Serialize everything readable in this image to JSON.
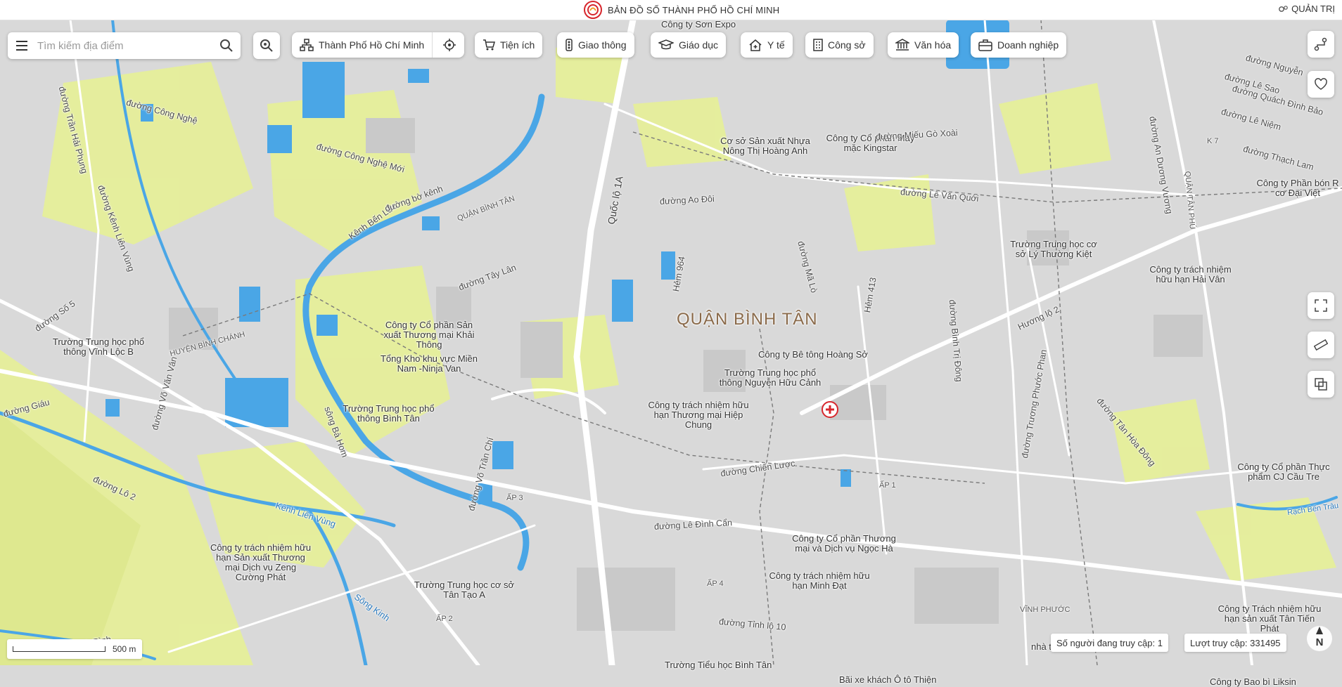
{
  "header": {
    "title": "BẢN ĐỒ SỐ THÀNH PHỐ HỒ CHÍ MINH",
    "admin_label": "QUẢN TRỊ",
    "logo_icon": "city-logo-icon"
  },
  "search": {
    "placeholder": "Tìm kiếm địa điểm"
  },
  "toolbar": {
    "city_selector": "Thành Phố Hồ Chí Minh",
    "categories": [
      {
        "label": "Tiện ích",
        "icon": "cart-icon"
      },
      {
        "label": "Giao thông",
        "icon": "traffic-light-icon"
      },
      {
        "label": "Giáo dục",
        "icon": "graduation-cap-icon"
      },
      {
        "label": "Y tế",
        "icon": "medical-house-icon"
      },
      {
        "label": "Công sở",
        "icon": "office-building-icon"
      },
      {
        "label": "Văn hóa",
        "icon": "museum-icon"
      },
      {
        "label": "Doanh nghiệp",
        "icon": "briefcase-icon"
      }
    ]
  },
  "map": {
    "district": "QUẬN BÌNH TÂN",
    "labels": [
      "Công ty Sơn Expo",
      "đường Công Nghệ",
      "đường Trần Hải Phụng",
      "đường Công Nghệ Mới",
      "đường Kênh Liên Vùng",
      "Kênh Bến Lức",
      "đường bờ kênh",
      "QUẬN BÌNH TÂN",
      "HUYỆN BÌNH CHÁNH",
      "đường Tây Lân",
      "Quốc lộ 1A",
      "đường Ao Đôi",
      "Hẻm 964",
      "đường Mã Lò",
      "Hẻm 413",
      "Cơ sở Sản xuất Nhựa Nông Thị Hoàng Anh",
      "Công ty Cổ phần May mặc Kingstar",
      "đường Miếu Gò Xoài",
      "đường Lê Văn Quới",
      "Trường Trung học cơ sở Lý Thường Kiệt",
      "Công ty trách nhiệm hữu hạn Hải Vân",
      "Hương lộ 2",
      "đường Bình Trị Đông",
      "đường Trương Phước Phan",
      "đường An Dương Vương",
      "Công ty Phần bón R cơ Đại Việt",
      "Công ty Cổ phần Sản xuất Thương mại Khải Thông",
      "Tổng Kho khu vực Miền Nam -Ninja Van",
      "Trường Trung học phổ thông Vĩnh Lộc B",
      "đường Võ Văn Vân",
      "đường Số 5",
      "Trường Trung học phổ thông Bình Tân",
      "sông Bà Hom",
      "Công ty Bê tông Hoàng Sở",
      "Trường Trung học phổ thông Nguyễn Hữu Cảnh",
      "Công ty trách nhiệm hữu hạn Thương mại Hiệp Chung",
      "đường Chiến Lược",
      "đường Tân Hòa Đông",
      "Công ty Cổ phần Thực phẩm CJ Cầu Tre",
      "Rạch Bến Trâu",
      "đường Võ Trần Chí",
      "ẤP 3",
      "ẤP 1",
      "ẤP 4",
      "ẤP 2",
      "đường Lê Đình Cẩn",
      "đường Tỉnh lộ 10",
      "Công ty trách nhiệm hữu hạn Sản xuất Thương mại Dịch vụ Zeng Cường Phát",
      "Kênh Liên Vùng",
      "đường Lô 2",
      "Công ty Cổ phần Thương mại và Dịch vụ Ngọc Hà",
      "Công ty trách nhiệm hữu hạn Minh Đạt",
      "Trường Trung học cơ sở Tân Tạo A",
      "Sông Kinh",
      "Trường Tiểu học Bình Tân",
      "nhà thờ Thánh Phaolo",
      "VĨNH PHƯỚC",
      "Công ty Trách nhiệm hữu hạn sản xuất Tân Tiến Phát",
      "Bãi xe khách Ô tô Thiện",
      "Công ty Bao bì Liksin",
      "đường Lê Niệm",
      "đường Lê Sao",
      "đường Quách Đình Bảo",
      "đường Thạch Lam",
      "đường Nguyễn",
      "QUẬN TÂN PHÚ",
      "K 7",
      "Kênh Bình",
      "đường Giáu"
    ]
  },
  "scale": {
    "label": "500 m"
  },
  "stats": {
    "online": "Số người đang truy cập: 1",
    "total": "Lượt truy cập: 331495"
  },
  "compass": {
    "label": "N"
  },
  "colors": {
    "water": "#4aa6e6",
    "green": "#e6ef9a",
    "road": "#ffffff",
    "land": "#d9d9d9",
    "brand_red": "#d7262c"
  }
}
